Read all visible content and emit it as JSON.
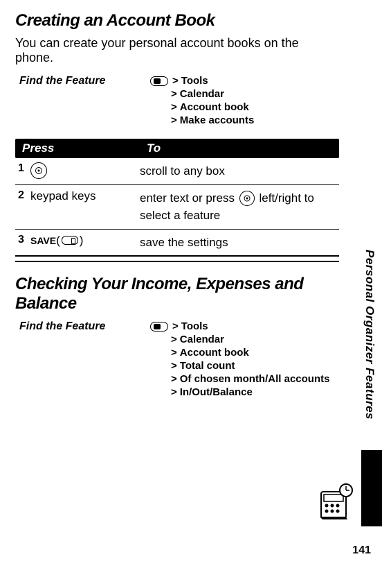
{
  "heading1": "Creating an Account Book",
  "intro1": "You can create your personal account books on the phone.",
  "findFeatureLabel": "Find the Feature",
  "featurePath1": [
    "Tools",
    "Calendar",
    "Account book",
    "Make accounts"
  ],
  "table": {
    "headers": {
      "press": "Press",
      "to": "To"
    },
    "rows": [
      {
        "num": "1",
        "pressType": "nav-icon",
        "to": "scroll to any box"
      },
      {
        "num": "2",
        "pressType": "text",
        "pressText": "keypad keys",
        "toPrefix": "enter text or press ",
        "toSuffix": " left/right to select a feature"
      },
      {
        "num": "3",
        "pressType": "save",
        "saveText": "SAVE",
        "to": "save the settings"
      }
    ]
  },
  "heading2": "Checking Your Income, Expenses and Balance",
  "featurePath2": [
    "Tools",
    "Calendar",
    "Account book",
    "Total count",
    "Of chosen month/All accounts",
    "In/Out/Balance"
  ],
  "verticalLabel": "Personal Organizer Features",
  "pageNumber": "141",
  "gtSymbol": ">",
  "openParen": "(",
  "closeParen": ")"
}
